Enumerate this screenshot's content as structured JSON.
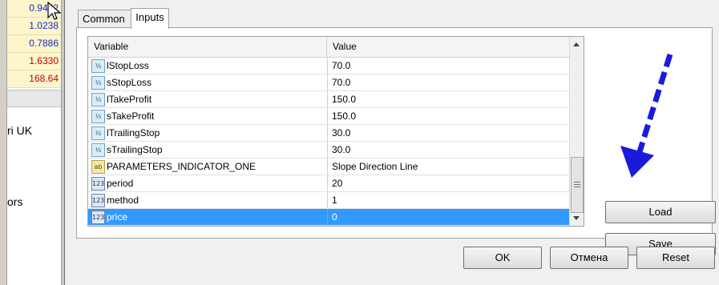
{
  "background_app": {
    "quotes": [
      {
        "value": "0.9452",
        "color": "blue"
      },
      {
        "value": "1.0238",
        "color": "blue"
      },
      {
        "value": "0.7886",
        "color": "blue"
      },
      {
        "value": "1.6330",
        "color": "red"
      },
      {
        "value": "168.64",
        "color": "red"
      }
    ],
    "text_lines": [
      "ri UK",
      "ors"
    ]
  },
  "dialog": {
    "tabs": [
      {
        "label": "Common",
        "active": false
      },
      {
        "label": "Inputs",
        "active": true
      }
    ],
    "grid": {
      "headers": {
        "variable": "Variable",
        "value": "Value"
      },
      "rows": [
        {
          "icon": "double",
          "name": "lStopLoss",
          "value": "70.0"
        },
        {
          "icon": "double",
          "name": "sStopLoss",
          "value": "70.0"
        },
        {
          "icon": "double",
          "name": "lTakeProfit",
          "value": "150.0"
        },
        {
          "icon": "double",
          "name": "sTakeProfit",
          "value": "150.0"
        },
        {
          "icon": "double",
          "name": "lTrailingStop",
          "value": "30.0"
        },
        {
          "icon": "double",
          "name": "sTrailingStop",
          "value": "30.0"
        },
        {
          "icon": "string",
          "name": "PARAMETERS_INDICATOR_ONE",
          "value": "Slope Direction Line"
        },
        {
          "icon": "integer",
          "name": "period",
          "value": "20"
        },
        {
          "icon": "integer",
          "name": "method",
          "value": "1"
        },
        {
          "icon": "integer",
          "name": "price",
          "value": "0",
          "selected": true
        }
      ],
      "icon_glyphs": {
        "double": "½",
        "string": "ab",
        "integer": "123"
      }
    },
    "buttons": {
      "load": "Load",
      "save": "Save",
      "ok": "OK",
      "cancel": "Отмена",
      "reset": "Reset"
    }
  },
  "colors": {
    "selection": "#3399ff",
    "annotation_arrow": "#1a1adc"
  }
}
